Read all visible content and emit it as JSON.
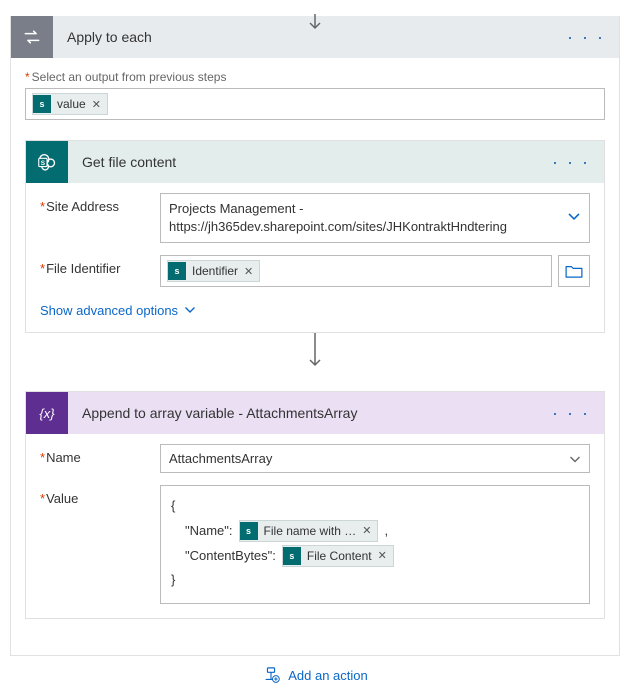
{
  "applyToEach": {
    "title": "Apply to each",
    "selectOutputLabel": "Select an output from previous steps",
    "outputToken": "value"
  },
  "getFileContent": {
    "title": "Get file content",
    "siteAddressLabel": "Site Address",
    "siteAddressValue": "Projects Management - https://jh365dev.sharepoint.com/sites/JHKontraktHndtering",
    "fileIdentifierLabel": "File Identifier",
    "fileIdentifierToken": "Identifier",
    "advancedLink": "Show advanced options"
  },
  "appendArray": {
    "title": "Append to array variable - AttachmentsArray",
    "nameLabel": "Name",
    "nameValue": "AttachmentsArray",
    "valueLabel": "Value",
    "json": {
      "open": "{",
      "key1": "\"Name\":",
      "token1": "File name with …",
      "comma": ",",
      "key2": "\"ContentBytes\":",
      "token2": "File Content",
      "close": "}"
    }
  },
  "addAction": "Add an action"
}
